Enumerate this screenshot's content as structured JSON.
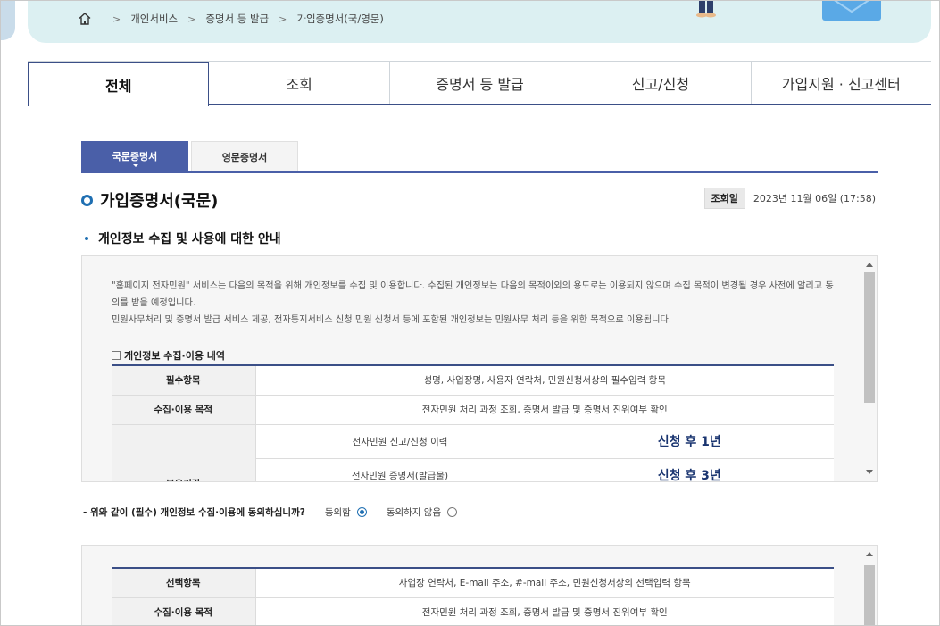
{
  "breadcrumb": {
    "items": [
      "개인서비스",
      "증명서 등 발급",
      "가입증명서(국/영문)"
    ],
    "separator": ">"
  },
  "main_tabs": [
    {
      "label": "전체",
      "active": true
    },
    {
      "label": "조회",
      "active": false
    },
    {
      "label": "증명서 등 발급",
      "active": false
    },
    {
      "label": "신고/신청",
      "active": false
    },
    {
      "label": "가입지원 · 신고센터",
      "active": false
    }
  ],
  "sub_tabs": [
    {
      "label": "국문증명서",
      "active": true
    },
    {
      "label": "영문증명서",
      "active": false
    }
  ],
  "page": {
    "title": "가입증명서(국문)",
    "date_badge": "조회일",
    "date_value": "2023년 11월 06일 (17:58)",
    "section_title": "개인정보 수집 및 사용에 대한 안내"
  },
  "privacy_box": {
    "intro_line1": "\"홈페이지 전자민원\" 서비스는 다음의 목적을 위해 개인정보를 수집 및 이용합니다. 수집된 개인정보는 다음의 목적이외의 용도로는 이용되지 않으며 수집 목적이 변경될 경우 사전에 알리고 동의를 받을 예정입니다.",
    "intro_line2": "민원사무처리 및 증명서 발급 서비스 제공, 전자통지서비스 신청 민원 신청서 등에 포함된 개인정보는 민원사무 처리 등을 위한 목적으로 이용됩니다.",
    "subhead": "개인정보 수집·이용 내역",
    "rows": {
      "required_label": "필수항목",
      "required_value": "성명, 사업장명, 사용자 연락처, 민원신청서상의 필수입력 항목",
      "purpose_label": "수집·이용 목적",
      "purpose_value": "전자민원 처리 과정 조회, 증명서 발급 및 증명서 진위여부 확인",
      "retention_label": "보유기간",
      "retention_item1": "전자민원 신고/신청 이력",
      "retention_term1": "신청 후 1년",
      "retention_item2": "전자민원 증명서(발급물)",
      "retention_term2": "신청 후 3년"
    }
  },
  "consent": {
    "question": "- 위와 같이 (필수) 개인정보 수집·이용에 동의하십니까?",
    "agree_label": "동의함",
    "agree_selected": true,
    "disagree_label": "동의하지 않음",
    "disagree_selected": false
  },
  "optional_box": {
    "rows": {
      "optional_label": "선택항목",
      "optional_value": "사업장 연락처, E-mail 주소, #-mail 주소, 민원신청서상의 선택입력 항목",
      "purpose_label": "수집·이용 목적",
      "purpose_value": "전자민원 처리 과정 조회, 증명서 발급 및 증명서 진위여부 확인"
    }
  },
  "colors": {
    "accent": "#4a5fa8",
    "title_ring": "#1f6fb2",
    "banner": "#dcf0f2",
    "term_text": "#1a3570"
  }
}
